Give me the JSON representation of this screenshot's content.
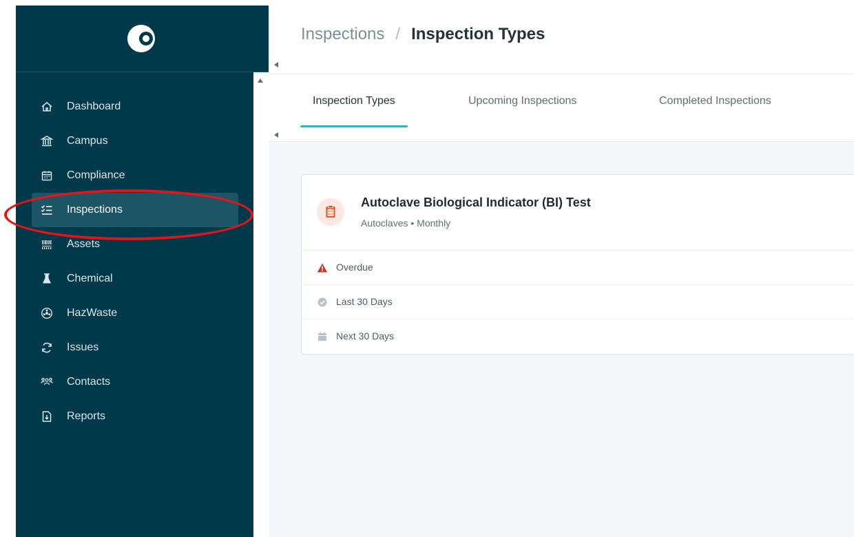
{
  "sidebar": {
    "items": [
      {
        "label": "Dashboard",
        "icon": "home-icon"
      },
      {
        "label": "Campus",
        "icon": "building-icon"
      },
      {
        "label": "Compliance",
        "icon": "calendar-icon"
      },
      {
        "label": "Inspections",
        "icon": "checklist-icon",
        "active": true
      },
      {
        "label": "Assets",
        "icon": "barcode-icon"
      },
      {
        "label": "Chemical",
        "icon": "flask-icon"
      },
      {
        "label": "HazWaste",
        "icon": "radiation-icon"
      },
      {
        "label": "Issues",
        "icon": "refresh-icon"
      },
      {
        "label": "Contacts",
        "icon": "users-icon"
      },
      {
        "label": "Reports",
        "icon": "report-icon"
      }
    ]
  },
  "header": {
    "breadcrumb_parent": "Inspections",
    "breadcrumb_separator": "/",
    "breadcrumb_current": "Inspection Types"
  },
  "tabs": [
    {
      "label": "Inspection Types",
      "active": true
    },
    {
      "label": "Upcoming Inspections"
    },
    {
      "label": "Completed Inspections"
    }
  ],
  "inspection_type": {
    "title": "Autoclave Biological Indicator (BI) Test",
    "subtitle": "Autoclaves • Monthly",
    "rows": [
      {
        "label": "Overdue",
        "icon": "warning-icon"
      },
      {
        "label": "Last 30 Days",
        "icon": "check-circle-icon"
      },
      {
        "label": "Next 30 Days",
        "icon": "calendar-icon"
      }
    ]
  },
  "colors": {
    "sidebar_bg": "#003a4a",
    "active_item_bg": "#1c5566",
    "tab_underline": "#3aaec4",
    "warning": "#c0392b",
    "highlight": "#e0151b"
  }
}
